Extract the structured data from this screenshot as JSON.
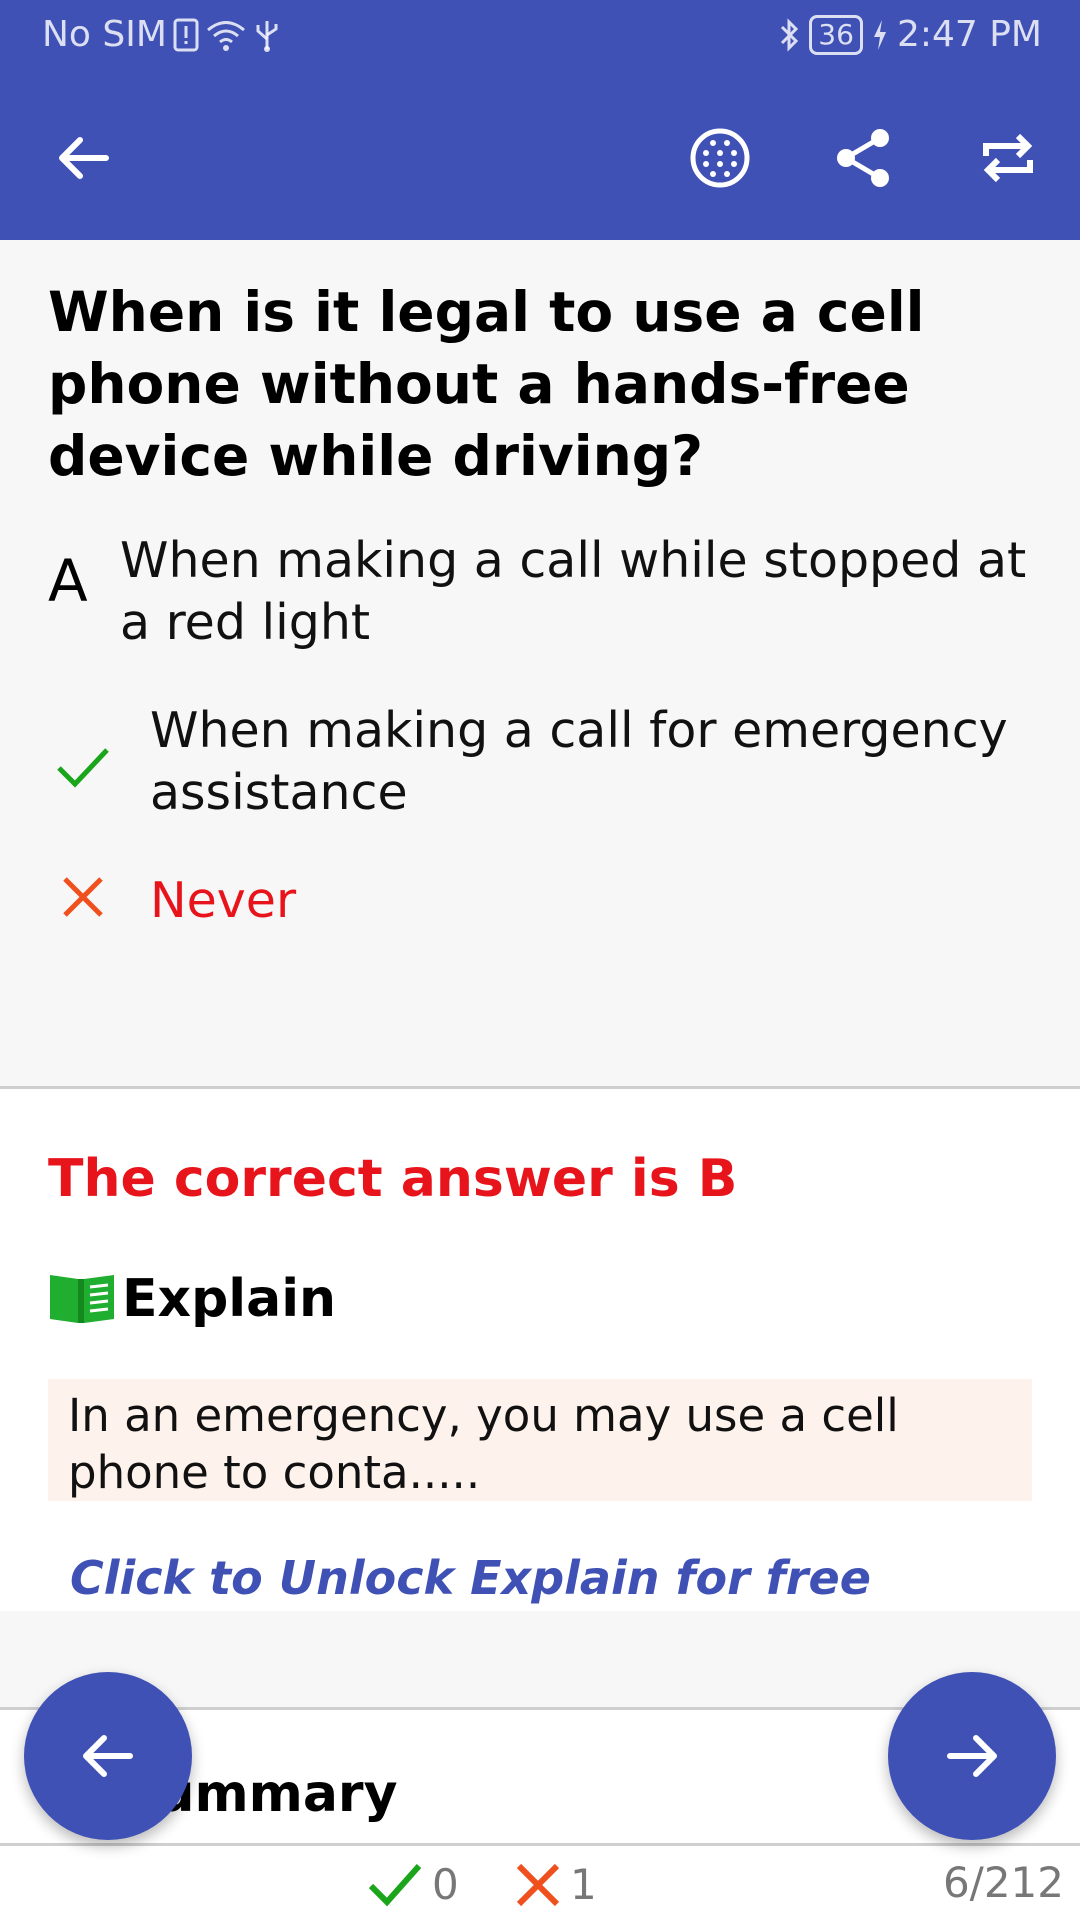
{
  "status_bar": {
    "carrier": "No SIM",
    "battery": "36",
    "time": "2:47 PM"
  },
  "app_bar": {
    "icons": [
      "back-arrow-icon",
      "translate-icon",
      "share-icon",
      "repeat-icon"
    ]
  },
  "question": {
    "text": "When is it legal to use a cell phone without a hands-free device while driving?",
    "options": [
      {
        "marker": "A",
        "text": "When making a call while stopped at a red light",
        "state": "default"
      },
      {
        "marker": "check",
        "text": "When making a call for emergency assistance",
        "state": "correct"
      },
      {
        "marker": "cross",
        "text": "Never",
        "state": "wrong"
      }
    ]
  },
  "answer": {
    "correct_text": "The correct answer is B",
    "explain_title": "Explain",
    "explain_text": "In an emergency, you may use a cell phone to conta.....",
    "unlock_text": "Click to Unlock Explain for free"
  },
  "summary": {
    "title": "Summary"
  },
  "stats": {
    "correct_count": "0",
    "wrong_count": "1",
    "progress": "6/212"
  },
  "colors": {
    "primary": "#3f51b5",
    "correct": "#1aa51a",
    "wrong": "#f0501e",
    "answer_red": "#e8141b"
  }
}
